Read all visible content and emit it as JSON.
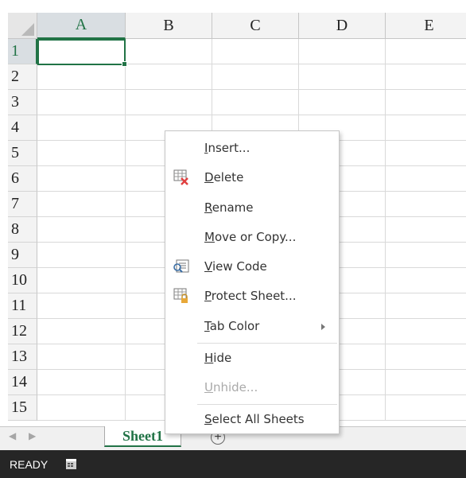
{
  "columns": [
    "A",
    "B",
    "C",
    "D",
    "E"
  ],
  "rows": [
    "1",
    "2",
    "3",
    "4",
    "5",
    "6",
    "7",
    "8",
    "9",
    "10",
    "11",
    "12",
    "13",
    "14",
    "15"
  ],
  "selected_cell": "A1",
  "sheet_tabs": [
    {
      "label": "Sheet1",
      "active": true
    }
  ],
  "status": {
    "text": "READY"
  },
  "context_menu": {
    "items": [
      {
        "label": "Insert...",
        "mnemonic": "I",
        "icon": null,
        "enabled": true
      },
      {
        "label": "Delete",
        "mnemonic": "D",
        "icon": "delete-sheet-icon",
        "enabled": true
      },
      {
        "label": "Rename",
        "mnemonic": "R",
        "icon": null,
        "enabled": true
      },
      {
        "label": "Move or Copy...",
        "mnemonic": "M",
        "icon": null,
        "enabled": true
      },
      {
        "label": "View Code",
        "mnemonic": "V",
        "icon": "view-code-icon",
        "enabled": true
      },
      {
        "label": "Protect Sheet...",
        "mnemonic": "P",
        "icon": "protect-sheet-icon",
        "enabled": true
      },
      {
        "label": "Tab Color",
        "mnemonic": "T",
        "icon": null,
        "enabled": true,
        "submenu": true
      },
      {
        "label": "Hide",
        "mnemonic": "H",
        "icon": null,
        "enabled": true
      },
      {
        "label": "Unhide...",
        "mnemonic": "U",
        "icon": null,
        "enabled": false
      },
      {
        "label": "Select All Sheets",
        "mnemonic": "S",
        "icon": null,
        "enabled": true
      }
    ]
  },
  "colors": {
    "accent": "#217346",
    "status_bar": "#262626",
    "header_bg": "#f3f3f3"
  }
}
